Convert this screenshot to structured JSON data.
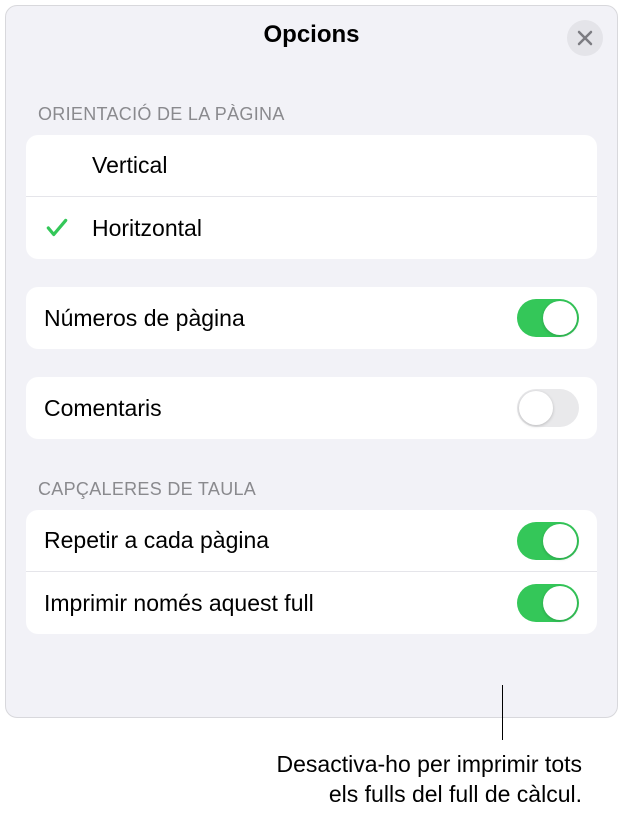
{
  "header": {
    "title": "Opcions"
  },
  "sections": {
    "orientation": {
      "header": "ORIENTACIÓ DE LA PÀGINA",
      "vertical": "Vertical",
      "horizontal": "Horitzontal"
    },
    "pageNumbers": {
      "label": "Números de pàgina"
    },
    "comments": {
      "label": "Comentaris"
    },
    "tableHeaders": {
      "header": "CAPÇALERES DE TAULA",
      "repeat": "Repetir a cada pàgina",
      "printOnly": "Imprimir només aquest full"
    }
  },
  "callout": {
    "line1": "Desactiva-ho per imprimir tots",
    "line2": "els fulls del full de càlcul."
  }
}
